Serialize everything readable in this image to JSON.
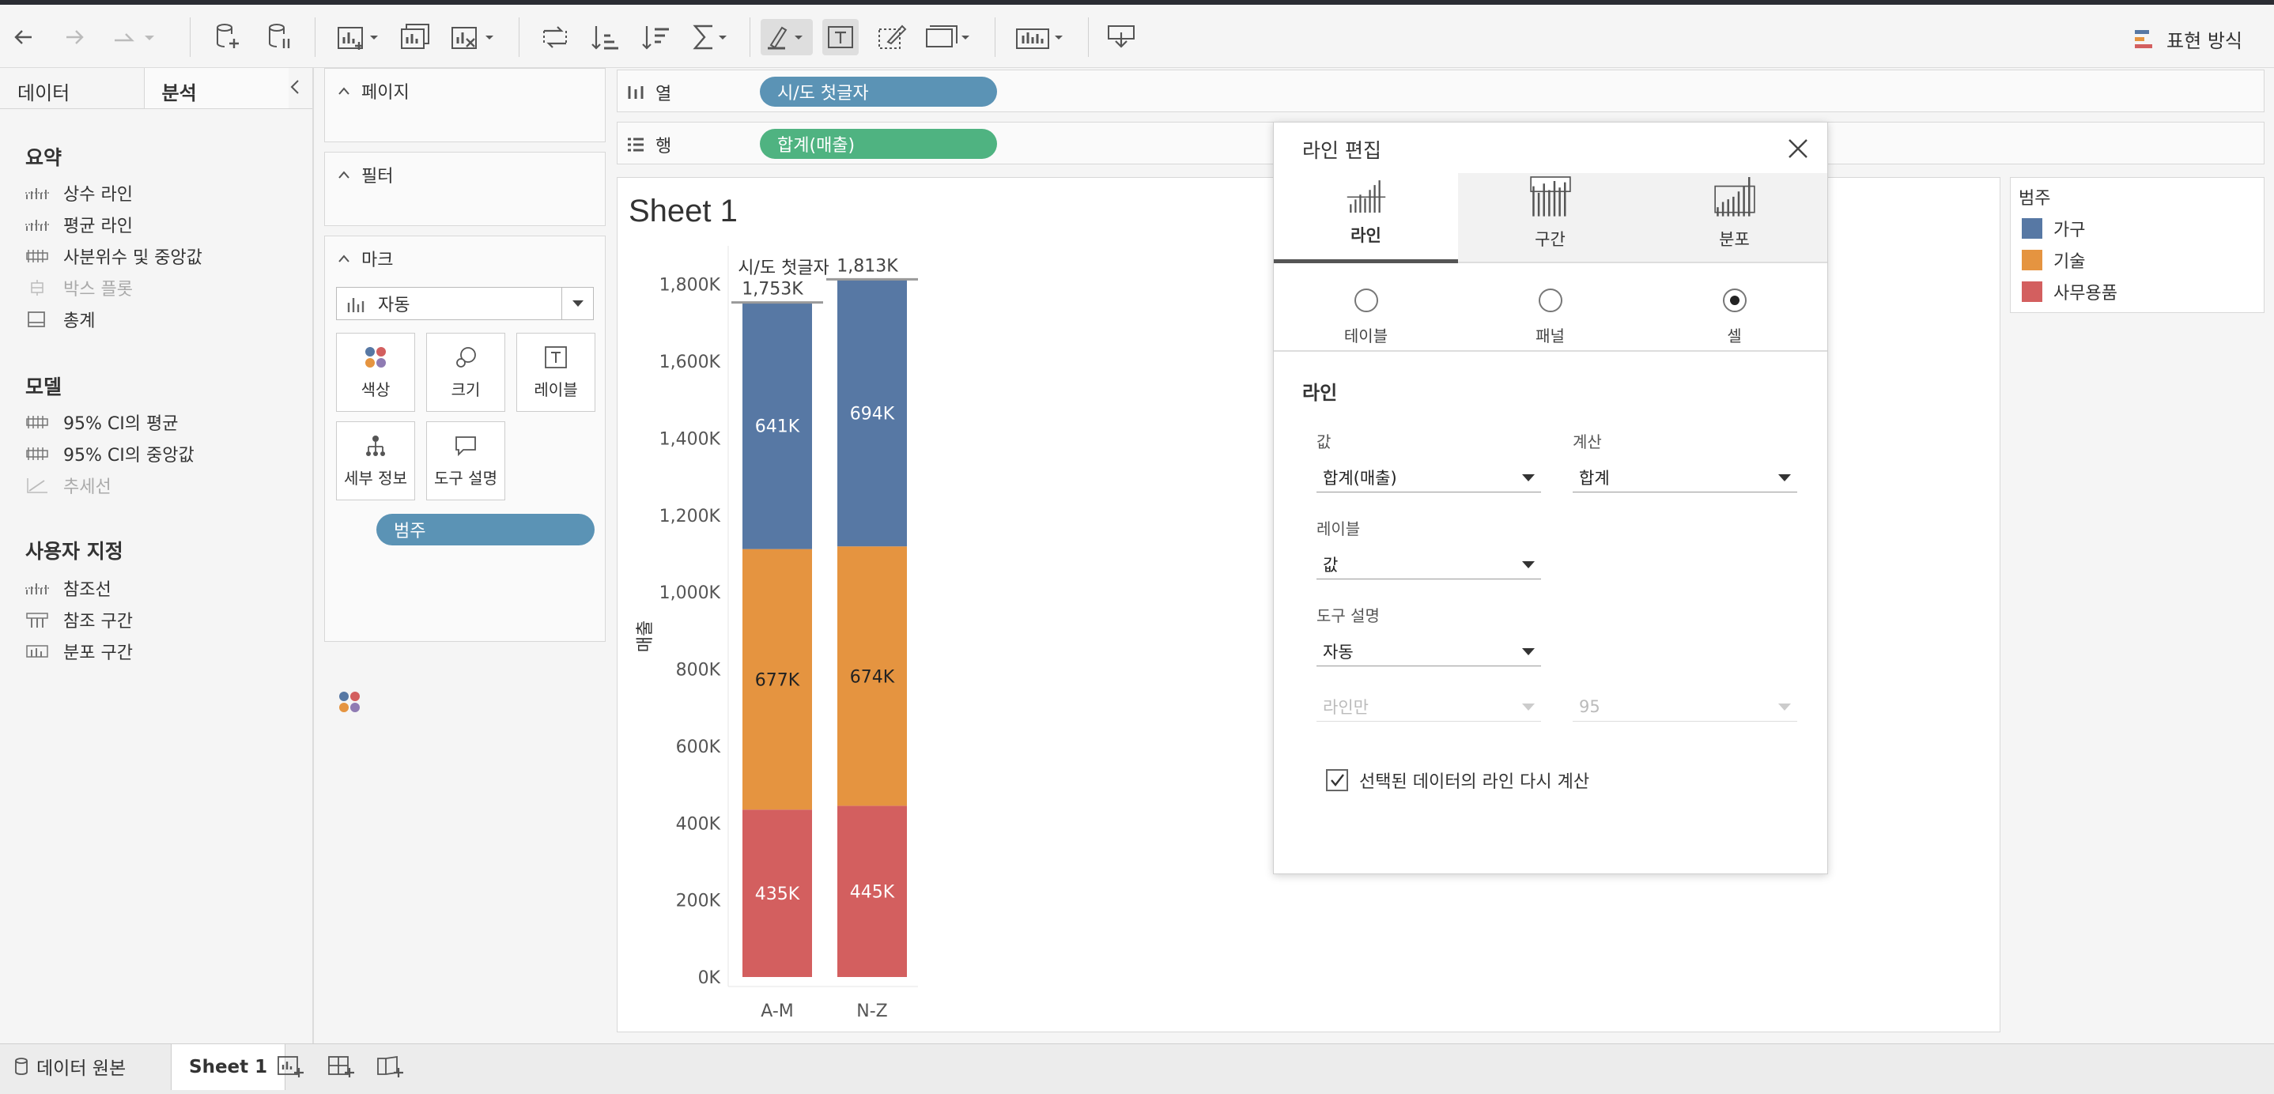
{
  "toolbar": {
    "show_me_label": "표현 방식",
    "icons": [
      "back-icon",
      "forward-icon",
      "redo-icon",
      "new-datasource-icon",
      "pause-updates-icon",
      "new-worksheet-icon",
      "duplicate-sheet-icon",
      "clear-sheet-icon",
      "swap-icon",
      "sort-ascending-icon",
      "sort-descending-icon",
      "totals-icon",
      "highlight-icon",
      "show-labels-icon",
      "format-icon",
      "fit-icon",
      "show-cards-icon",
      "presentation-icon"
    ]
  },
  "left_panel": {
    "tabs": [
      "데이터",
      "분석"
    ],
    "active_tab": "분석",
    "sections": [
      {
        "title": "요약",
        "items": [
          {
            "label": "상수 라인",
            "enabled": true
          },
          {
            "label": "평균 라인",
            "enabled": true
          },
          {
            "label": "사분위수 및 중앙값",
            "enabled": true
          },
          {
            "label": "박스 플롯",
            "enabled": false
          },
          {
            "label": "총계",
            "enabled": true
          }
        ]
      },
      {
        "title": "모델",
        "items": [
          {
            "label": "95% CI의 평균",
            "enabled": true
          },
          {
            "label": "95% CI의 중앙값",
            "enabled": true
          },
          {
            "label": "추세선",
            "enabled": false
          }
        ]
      },
      {
        "title": "사용자 지정",
        "items": [
          {
            "label": "참조선",
            "enabled": true
          },
          {
            "label": "참조 구간",
            "enabled": true
          },
          {
            "label": "분포 구간",
            "enabled": true
          }
        ]
      }
    ]
  },
  "cards": {
    "pages": "페이지",
    "filters": "필터",
    "marks": "마크",
    "mark_type": "자동",
    "mark_buttons": [
      "색상",
      "크기",
      "레이블",
      "세부 정보",
      "도구 설명"
    ],
    "color_pill": "범주"
  },
  "shelves": {
    "columns_label": "열",
    "columns_pill": "시/도 첫글자",
    "rows_label": "행",
    "rows_pill": "합계(매출)",
    "columns_color": "#5b93b5",
    "rows_color": "#4fb381"
  },
  "sheet": {
    "title": "Sheet 1"
  },
  "chart_data": {
    "type": "bar",
    "stacked": true,
    "title": "시/도 첫글자",
    "xlabel": "",
    "ylabel": "매출",
    "categories": [
      "A-M",
      "N-Z"
    ],
    "series": [
      {
        "name": "사무용품",
        "values": [
          435,
          445
        ],
        "labels": [
          "435K",
          "445K"
        ],
        "color": "#d35f5f"
      },
      {
        "name": "기술",
        "values": [
          677,
          674
        ],
        "labels": [
          "677K",
          "674K"
        ],
        "color": "#e59440"
      },
      {
        "name": "가구",
        "values": [
          641,
          694
        ],
        "labels": [
          "641K",
          "694K"
        ],
        "color": "#5778a4"
      }
    ],
    "totals": [
      "1,753K",
      "1,813K"
    ],
    "reference_line_values": [
      1753,
      1813
    ],
    "y_ticks": [
      "0K",
      "200K",
      "400K",
      "600K",
      "800K",
      "1,000K",
      "1,200K",
      "1,400K",
      "1,600K",
      "1,800K"
    ],
    "ylim": [
      0,
      1900
    ],
    "grid": false
  },
  "legend": {
    "title": "범주",
    "items": [
      {
        "label": "가구",
        "color": "#5778a4"
      },
      {
        "label": "기술",
        "color": "#e59440"
      },
      {
        "label": "사무용품",
        "color": "#d35f5f"
      }
    ]
  },
  "dialog": {
    "title": "라인 편집",
    "tabs": [
      "라인",
      "구간",
      "분포"
    ],
    "active_tab": "라인",
    "scope_options": [
      "테이블",
      "패널",
      "셀"
    ],
    "scope_selected": "셀",
    "section_title": "라인",
    "value_label": "값",
    "value_select": "합계(매출)",
    "calc_label": "계산",
    "calc_select": "합계",
    "label_label": "레이블",
    "label_select": "값",
    "tooltip_label": "도구 설명",
    "tooltip_select": "자동",
    "line_only_select": "라인만",
    "percent_select": "95",
    "recalc_label": "선택된 데이터의 라인 다시 계산",
    "recalc_checked": true
  },
  "bottombar": {
    "datasource_label": "데이터 원본",
    "sheet_tab": "Sheet 1"
  }
}
